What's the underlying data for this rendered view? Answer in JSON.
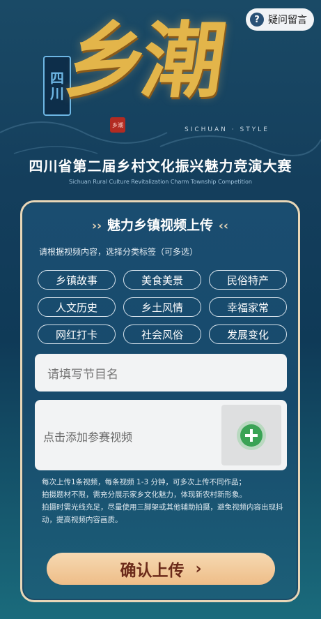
{
  "help_button": {
    "icon": "question-icon",
    "label": "疑问留言"
  },
  "logo": {
    "main_text": "乡潮",
    "vertical_seal": [
      "四",
      "川"
    ],
    "red_seal": "乡潮",
    "style_text": "SICHUAN · STYLE"
  },
  "title": "四川省第二届乡村文化振兴魅力竞演大赛",
  "subtitle": "Sichuan  Rural Culture Revitalization Charm Township Competition",
  "card": {
    "header": "魅力乡镇视频上传",
    "header_left": "››",
    "header_right": "‹‹",
    "hint": "请根据视频内容，选择分类标签（可多选）",
    "tags": [
      "乡镇故事",
      "美食美景",
      "民俗特产",
      "人文历史",
      "乡土风情",
      "幸福家常",
      "网红打卡",
      "社会风俗",
      "发展变化"
    ],
    "name_input": {
      "placeholder": "请填写节目名"
    },
    "video": {
      "label": "点击添加参赛视频",
      "add_icon": "plus-icon"
    },
    "notes": [
      "每次上传1条视频，每条视频 1-3 分钟，可多次上传不同作品；",
      "拍摄题材不限，需充分展示家乡文化魅力，体现新农村新形象。",
      "拍摄时需光线充足，尽量使用三脚架或其他辅助拍摄，避免视频内容出现抖动，提高视频内容画质。"
    ],
    "submit": {
      "label": "确认上传",
      "chevron": "›"
    }
  },
  "colors": {
    "bg": "#143e5c",
    "card_border": "#e9d7b8",
    "button": "#eebd88",
    "accent_green": "#3aa355"
  }
}
